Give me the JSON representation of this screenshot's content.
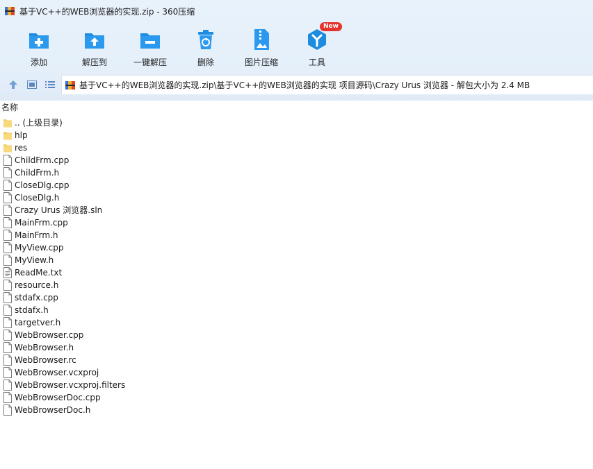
{
  "window": {
    "title": "基于VC++的WEB浏览器的实现.zip - 360压缩"
  },
  "toolbar": {
    "items": [
      {
        "label": "添加",
        "icon": "add-icon"
      },
      {
        "label": "解压到",
        "icon": "extract-to-icon"
      },
      {
        "label": "一键解压",
        "icon": "one-click-extract-icon"
      },
      {
        "label": "删除",
        "icon": "delete-icon"
      },
      {
        "label": "图片压缩",
        "icon": "image-compress-icon"
      },
      {
        "label": "工具",
        "icon": "tools-icon",
        "badge": "New"
      }
    ]
  },
  "address": {
    "path": "基于VC++的WEB浏览器的实现.zip\\基于VC++的WEB浏览器的实现 项目源码\\Crazy Urus 浏览器 - 解包大小为 2.4 MB"
  },
  "list": {
    "column_name": "名称",
    "files": [
      {
        "name": ".. (上级目录)",
        "type": "folder"
      },
      {
        "name": "hlp",
        "type": "folder"
      },
      {
        "name": "res",
        "type": "folder"
      },
      {
        "name": "ChildFrm.cpp",
        "type": "file"
      },
      {
        "name": "ChildFrm.h",
        "type": "file"
      },
      {
        "name": "CloseDlg.cpp",
        "type": "file"
      },
      {
        "name": "CloseDlg.h",
        "type": "file"
      },
      {
        "name": "Crazy Urus 浏览器.sln",
        "type": "file"
      },
      {
        "name": "MainFrm.cpp",
        "type": "file"
      },
      {
        "name": "MainFrm.h",
        "type": "file"
      },
      {
        "name": "MyView.cpp",
        "type": "file"
      },
      {
        "name": "MyView.h",
        "type": "file"
      },
      {
        "name": "ReadMe.txt",
        "type": "text"
      },
      {
        "name": "resource.h",
        "type": "file"
      },
      {
        "name": "stdafx.cpp",
        "type": "file"
      },
      {
        "name": "stdafx.h",
        "type": "file"
      },
      {
        "name": "targetver.h",
        "type": "file"
      },
      {
        "name": "WebBrowser.cpp",
        "type": "file"
      },
      {
        "name": "WebBrowser.h",
        "type": "file"
      },
      {
        "name": "WebBrowser.rc",
        "type": "file"
      },
      {
        "name": "WebBrowser.vcxproj",
        "type": "file"
      },
      {
        "name": "WebBrowser.vcxproj.filters",
        "type": "file"
      },
      {
        "name": "WebBrowserDoc.cpp",
        "type": "file"
      },
      {
        "name": "WebBrowserDoc.h",
        "type": "file"
      }
    ]
  },
  "colors": {
    "toolbar_bg": "#e4effa",
    "icon_blue": "#1e8de0",
    "folder_yellow": "#f5cf6b",
    "badge_red": "#e5322d"
  }
}
